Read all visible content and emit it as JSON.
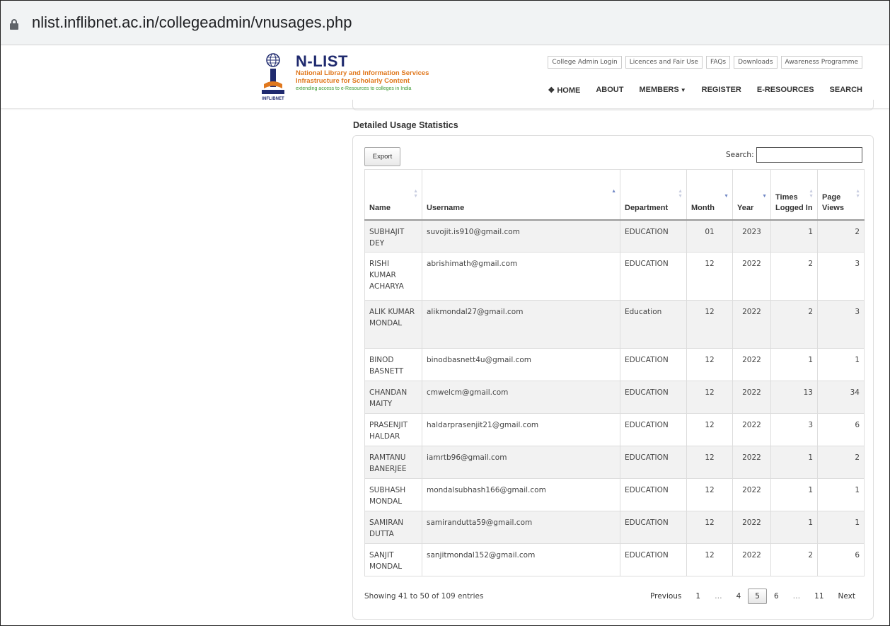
{
  "browser": {
    "url": "nlist.inflibnet.ac.in/collegeadmin/vnusages.php"
  },
  "header": {
    "logo": {
      "title": "N-LIST",
      "line1": "National Library and Information Services",
      "line2": "Infrastructure for Scholarly Content",
      "line3": "extending access to e-Resources to colleges in India",
      "org": "INFLIBNET"
    },
    "top_links": [
      "College Admin Login",
      "Licences and Fair Use",
      "FAQs",
      "Downloads",
      "Awareness Programme"
    ],
    "nav": {
      "home": "HOME",
      "about": "ABOUT",
      "members": "MEMBERS",
      "register": "REGISTER",
      "eresources": "E-RESOURCES",
      "search": "SEARCH"
    }
  },
  "section_title": "Detailed Usage Statistics",
  "toolbar": {
    "export_label": "Export",
    "search_label": "Search:",
    "search_value": ""
  },
  "table": {
    "columns": [
      "Name",
      "Username",
      "Department",
      "Month",
      "Year",
      "Times Logged In",
      "Page Views"
    ],
    "rows": [
      [
        "SUBHAJIT DEY",
        "suvojit.is910@gmail.com",
        "EDUCATION",
        "01",
        "2023",
        "1",
        "2"
      ],
      [
        "RISHI KUMAR ACHARYA",
        "abrishimath@gmail.com",
        "EDUCATION",
        "12",
        "2022",
        "2",
        "3"
      ],
      [
        "ALIK KUMAR MONDAL",
        "alikmondal27@gmail.com",
        "Education",
        "12",
        "2022",
        "2",
        "3"
      ],
      [
        "BINOD BASNETT",
        "binodbasnett4u@gmail.com",
        "EDUCATION",
        "12",
        "2022",
        "1",
        "1"
      ],
      [
        "CHANDAN MAITY",
        "cmwelcm@gmail.com",
        "EDUCATION",
        "12",
        "2022",
        "13",
        "34"
      ],
      [
        "PRASENJIT HALDAR",
        "haldarprasenjit21@gmail.com",
        "EDUCATION",
        "12",
        "2022",
        "3",
        "6"
      ],
      [
        "RAMTANU BANERJEE",
        "iamrtb96@gmail.com",
        "EDUCATION",
        "12",
        "2022",
        "1",
        "2"
      ],
      [
        "SUBHASH MONDAL",
        "mondalsubhash166@gmail.com",
        "EDUCATION",
        "12",
        "2022",
        "1",
        "1"
      ],
      [
        "SAMIRAN DUTTA",
        "samirandutta59@gmail.com",
        "EDUCATION",
        "12",
        "2022",
        "1",
        "1"
      ],
      [
        "SANJIT MONDAL",
        "sanjitmondal152@gmail.com",
        "EDUCATION",
        "12",
        "2022",
        "2",
        "6"
      ]
    ]
  },
  "footer": {
    "info": "Showing 41 to 50 of 109 entries",
    "pagination": {
      "previous": "Previous",
      "p1": "1",
      "ellipsis1": "…",
      "p4": "4",
      "p5": "5",
      "p6": "6",
      "ellipsis2": "…",
      "p11": "11",
      "next": "Next"
    }
  },
  "colors": {
    "logo_navy": "#1f2a6e",
    "logo_orange": "#e0781e",
    "logo_green": "#3d9b35",
    "row_stripe": "#f2f2f2",
    "sort_active": "#6f86c4"
  }
}
